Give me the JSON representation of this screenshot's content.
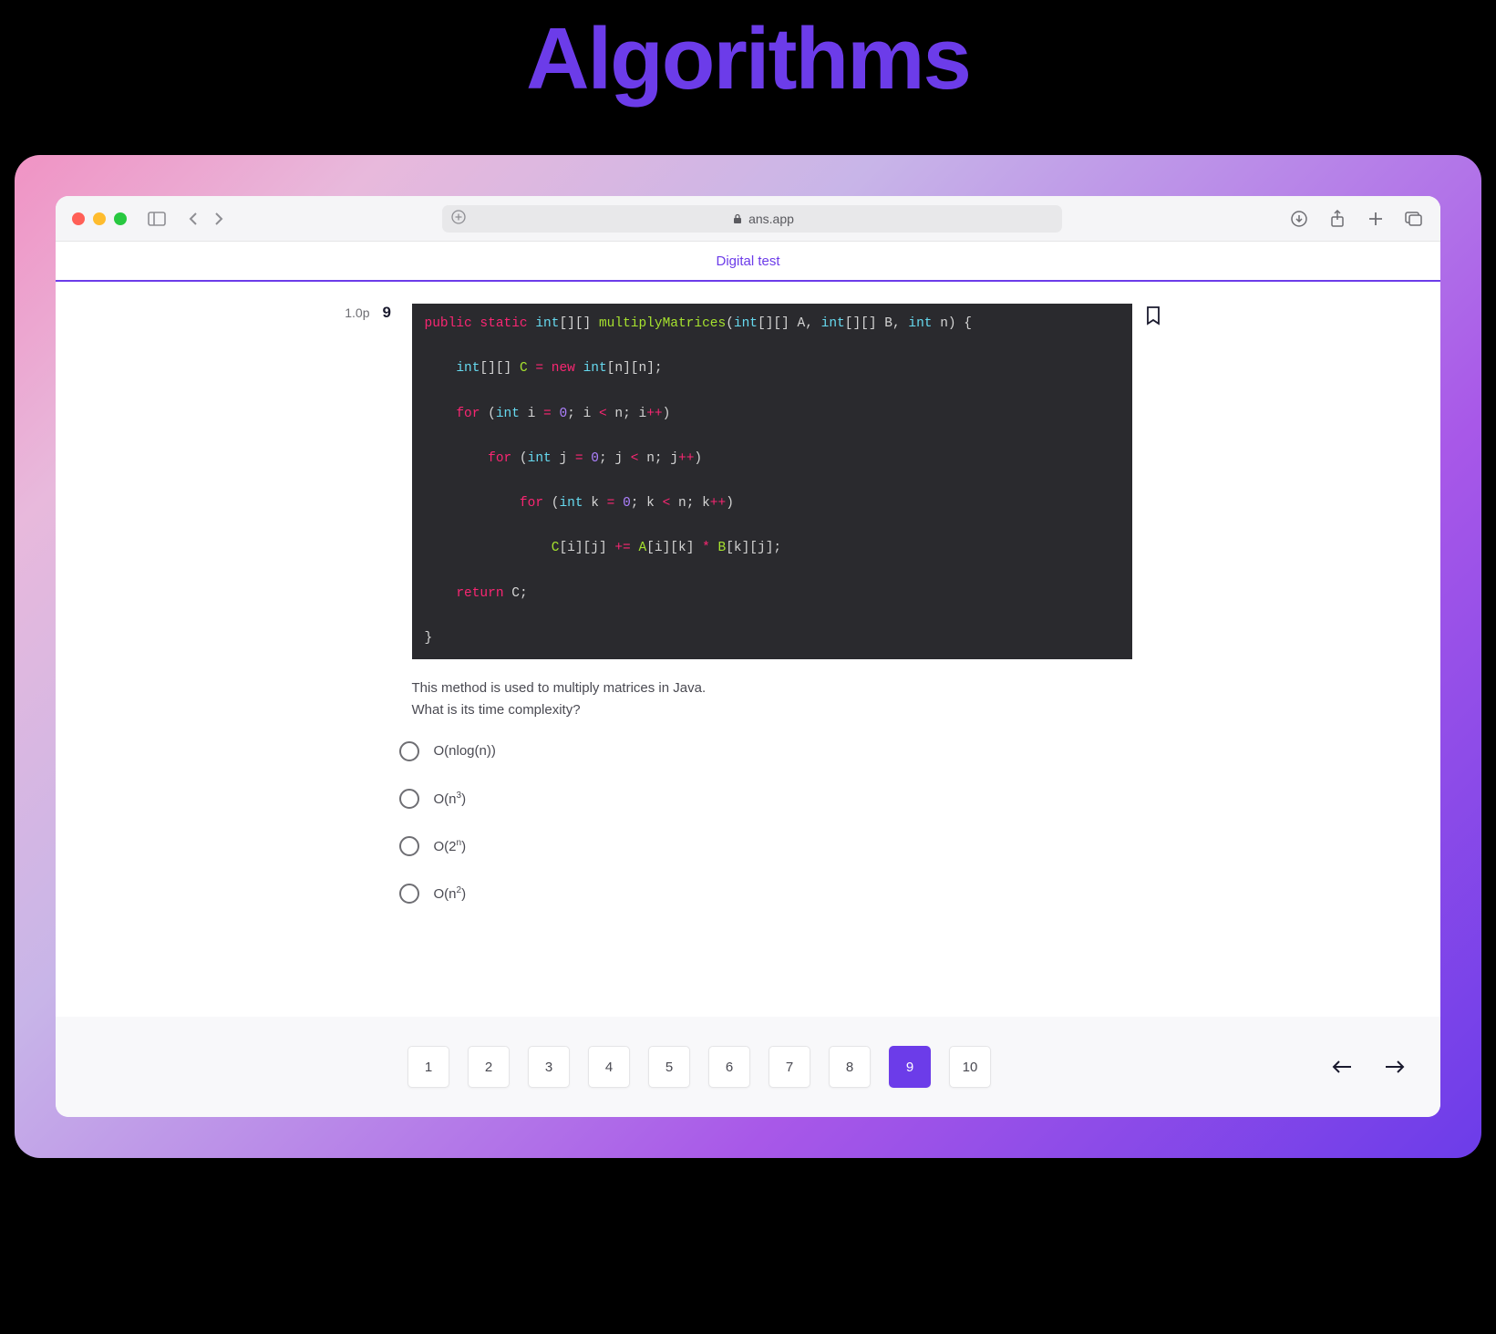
{
  "title": "Algorithms",
  "browser": {
    "url_host": "ans.app"
  },
  "app": {
    "header_title": "Digital test"
  },
  "question": {
    "points_label": "1.0p",
    "number": "9",
    "code_tokens": [
      [
        [
          "public",
          "kw1"
        ],
        [
          " ",
          ""
        ],
        [
          "static",
          "kw1"
        ],
        [
          " ",
          ""
        ],
        [
          "int",
          "kw3"
        ],
        [
          "[][] ",
          "punc"
        ],
        [
          "multiplyMatrices",
          "fn"
        ],
        [
          "(",
          "punc"
        ],
        [
          "int",
          "kw3"
        ],
        [
          "[][] ",
          "punc"
        ],
        [
          "A",
          "ident"
        ],
        [
          ", ",
          "punc"
        ],
        [
          "int",
          "kw3"
        ],
        [
          "[][] ",
          "punc"
        ],
        [
          "B",
          "ident"
        ],
        [
          ", ",
          "punc"
        ],
        [
          "int",
          "kw3"
        ],
        [
          " ",
          "punc"
        ],
        [
          "n",
          "ident"
        ],
        [
          ") {",
          "punc"
        ]
      ],
      [],
      [
        [
          "    ",
          ""
        ],
        [
          "int",
          "kw3"
        ],
        [
          "[][] ",
          "punc"
        ],
        [
          "C",
          "var"
        ],
        [
          " ",
          "punc"
        ],
        [
          "=",
          "op"
        ],
        [
          " ",
          "punc"
        ],
        [
          "new",
          "op"
        ],
        [
          " ",
          "punc"
        ],
        [
          "int",
          "kw3"
        ],
        [
          "[",
          "punc"
        ],
        [
          "n",
          "ident"
        ],
        [
          "][",
          "punc"
        ],
        [
          "n",
          "ident"
        ],
        [
          "];",
          "punc"
        ]
      ],
      [],
      [
        [
          "    ",
          ""
        ],
        [
          "for",
          "kw1"
        ],
        [
          " (",
          "punc"
        ],
        [
          "int",
          "kw3"
        ],
        [
          " ",
          "punc"
        ],
        [
          "i",
          "ident"
        ],
        [
          " ",
          "punc"
        ],
        [
          "=",
          "op"
        ],
        [
          " ",
          "punc"
        ],
        [
          "0",
          "num"
        ],
        [
          "; ",
          "punc"
        ],
        [
          "i",
          "ident"
        ],
        [
          " ",
          "punc"
        ],
        [
          "<",
          "op"
        ],
        [
          " ",
          "punc"
        ],
        [
          "n",
          "ident"
        ],
        [
          "; ",
          "punc"
        ],
        [
          "i",
          "ident"
        ],
        [
          "++",
          "op"
        ],
        [
          ")",
          "punc"
        ]
      ],
      [],
      [
        [
          "        ",
          ""
        ],
        [
          "for",
          "kw1"
        ],
        [
          " (",
          "punc"
        ],
        [
          "int",
          "kw3"
        ],
        [
          " ",
          "punc"
        ],
        [
          "j",
          "ident"
        ],
        [
          " ",
          "punc"
        ],
        [
          "=",
          "op"
        ],
        [
          " ",
          "punc"
        ],
        [
          "0",
          "num"
        ],
        [
          "; ",
          "punc"
        ],
        [
          "j",
          "ident"
        ],
        [
          " ",
          "punc"
        ],
        [
          "<",
          "op"
        ],
        [
          " ",
          "punc"
        ],
        [
          "n",
          "ident"
        ],
        [
          "; ",
          "punc"
        ],
        [
          "j",
          "ident"
        ],
        [
          "++",
          "op"
        ],
        [
          ")",
          "punc"
        ]
      ],
      [],
      [
        [
          "            ",
          ""
        ],
        [
          "for",
          "kw1"
        ],
        [
          " (",
          "punc"
        ],
        [
          "int",
          "kw3"
        ],
        [
          " ",
          "punc"
        ],
        [
          "k",
          "ident"
        ],
        [
          " ",
          "punc"
        ],
        [
          "=",
          "op"
        ],
        [
          " ",
          "punc"
        ],
        [
          "0",
          "num"
        ],
        [
          "; ",
          "punc"
        ],
        [
          "k",
          "ident"
        ],
        [
          " ",
          "punc"
        ],
        [
          "<",
          "op"
        ],
        [
          " ",
          "punc"
        ],
        [
          "n",
          "ident"
        ],
        [
          "; ",
          "punc"
        ],
        [
          "k",
          "ident"
        ],
        [
          "++",
          "op"
        ],
        [
          ")",
          "punc"
        ]
      ],
      [],
      [
        [
          "                ",
          ""
        ],
        [
          "C",
          "var"
        ],
        [
          "[",
          "punc"
        ],
        [
          "i",
          "ident"
        ],
        [
          "][",
          "punc"
        ],
        [
          "j",
          "ident"
        ],
        [
          "] ",
          "punc"
        ],
        [
          "+=",
          "op"
        ],
        [
          " ",
          "punc"
        ],
        [
          "A",
          "var"
        ],
        [
          "[",
          "punc"
        ],
        [
          "i",
          "ident"
        ],
        [
          "][",
          "punc"
        ],
        [
          "k",
          "ident"
        ],
        [
          "] ",
          "punc"
        ],
        [
          "*",
          "op"
        ],
        [
          " ",
          "punc"
        ],
        [
          "B",
          "var"
        ],
        [
          "[",
          "punc"
        ],
        [
          "k",
          "ident"
        ],
        [
          "][",
          "punc"
        ],
        [
          "j",
          "ident"
        ],
        [
          "];",
          "punc"
        ]
      ],
      [],
      [
        [
          "    ",
          ""
        ],
        [
          "return",
          "kw1"
        ],
        [
          " ",
          "punc"
        ],
        [
          "C",
          "ident"
        ],
        [
          ";",
          "punc"
        ]
      ],
      [],
      [
        [
          "}",
          "punc"
        ]
      ]
    ],
    "prompt_line1": "This method is used to multiply matrices in Java.",
    "prompt_line2": "What is its time complexity?",
    "options": [
      {
        "label_html": "O(nlog(n))"
      },
      {
        "label_html": "O(n<sup>3</sup>)"
      },
      {
        "label_html": "O(2<sup>n</sup>)"
      },
      {
        "label_html": "O(n<sup>2</sup>)"
      }
    ]
  },
  "pagination": {
    "pages": [
      "1",
      "2",
      "3",
      "4",
      "5",
      "6",
      "7",
      "8",
      "9",
      "10"
    ],
    "active": "9"
  }
}
